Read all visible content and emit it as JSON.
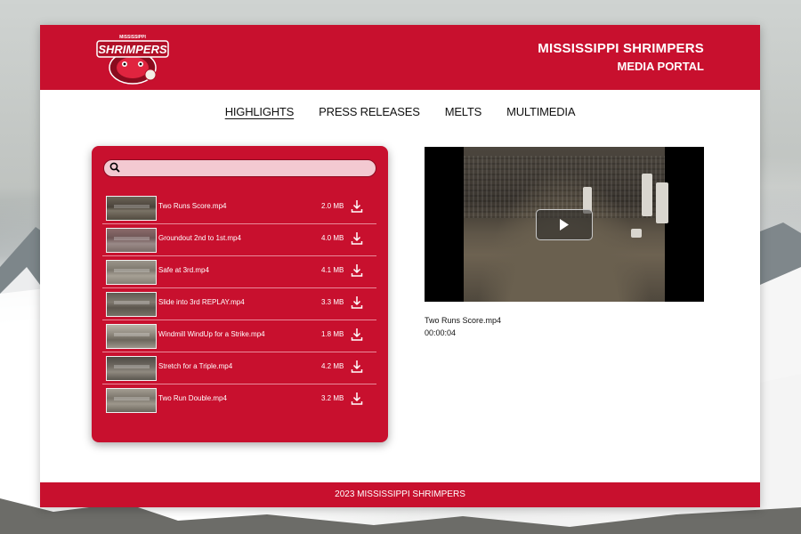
{
  "header": {
    "logo_text": "SHRIMPERS",
    "logo_subtext": "MISSISSIPPI",
    "title_line1": "MISSISSIPPI SHRIMPERS",
    "title_line2": "MEDIA PORTAL"
  },
  "nav": {
    "items": [
      {
        "label": "HIGHLIGHTS",
        "active": true
      },
      {
        "label": "PRESS RELEASES",
        "active": false
      },
      {
        "label": "MELTS",
        "active": false
      },
      {
        "label": "MULTIMEDIA",
        "active": false
      }
    ]
  },
  "search": {
    "placeholder": ""
  },
  "files": [
    {
      "name": "Two Runs Score.mp4",
      "size": "2.0 MB"
    },
    {
      "name": "Groundout 2nd to 1st.mp4",
      "size": "4.0 MB"
    },
    {
      "name": "Safe at 3rd.mp4",
      "size": "4.1 MB"
    },
    {
      "name": "Slide into 3rd REPLAY.mp4",
      "size": "3.3 MB"
    },
    {
      "name": "Windmill WindUp for a Strike.mp4",
      "size": "1.8 MB"
    },
    {
      "name": "Stretch for a Triple.mp4",
      "size": "4.2 MB"
    },
    {
      "name": "Two Run Double.mp4",
      "size": "3.2 MB"
    }
  ],
  "player": {
    "current_title": "Two Runs Score.mp4",
    "duration": "00:00:04"
  },
  "footer": {
    "text": "2023 MISSISSIPPI SHRIMPERS"
  },
  "colors": {
    "brand": "#c8102e",
    "search_bg": "#f3c9d1"
  },
  "icons": {
    "search": "search-icon",
    "download": "download-icon",
    "play": "play-icon"
  }
}
